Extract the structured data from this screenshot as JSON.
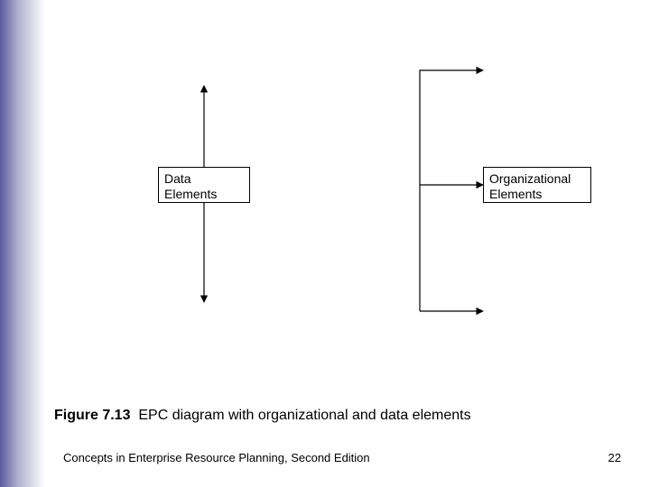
{
  "diagram": {
    "box_left": {
      "line1": "Data",
      "line2": "Elements"
    },
    "box_right": {
      "line1": "Organizational",
      "line2": "Elements"
    }
  },
  "caption": {
    "figure_label": "Figure 7.13",
    "figure_text": "EPC diagram with organizational and data elements"
  },
  "footer": {
    "book": "Concepts in Enterprise Resource Planning, Second Edition",
    "page": "22"
  }
}
